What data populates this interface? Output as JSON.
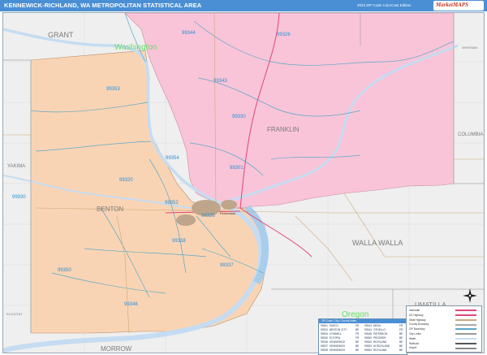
{
  "header": {
    "title": "KENNEWICK-RICHLAND, WA METROPOLITAN STATISTICAL AREA",
    "edition": "2023 ZIP Code ColorCast Edition",
    "brand": "MarketMAPS"
  },
  "colors": {
    "header_bg": "#4a8fd4",
    "benton_fill": "#f9d4b4",
    "franklin_fill": "#f9c4d8",
    "outside_fill": "#efefef",
    "water": "#c5dcf2",
    "zip_label": "#2a8fd6",
    "zip_border": "#5aa8c8",
    "county_label": "#7a7a7a",
    "state_label": "#66dd66",
    "highway": "#e0457b",
    "road": "#c9a97a"
  },
  "counties": {
    "grant": "GRANT",
    "yakima": "YAKIMA",
    "benton": "BENTON",
    "franklin": "FRANKLIN",
    "walla_walla": "WALLA WALLA",
    "columbia": "COLUMBIA",
    "whitman": "WHITMAN",
    "umatilla": "UMATILLA",
    "morrow": "MORROW",
    "klickitat": "KLICKITAT"
  },
  "states": {
    "washington": "Washington",
    "oregon": "Oregon"
  },
  "zips": {
    "z99344": "99344",
    "z99326": "99326",
    "z99343": "99343",
    "z99353": "99353",
    "z99330": "99330",
    "z99354": "99354",
    "z99301": "99301",
    "z99320": "99320",
    "z99930": "99930",
    "z99352": "99352",
    "z99336": "99336",
    "z99338": "99338",
    "z99337": "99337",
    "z99350": "99350",
    "z99348": "99348"
  },
  "cities": {
    "pasco": "Kennewick"
  },
  "legend": {
    "items": [
      "Interstate",
      "US Highway",
      "State Highway",
      "County Boundary",
      "ZIP Boundary",
      "City Limits",
      "Water",
      "Railroad",
      "Airport"
    ]
  },
  "zip_table": {
    "header": "ZIP Code / City / County Index",
    "rows": [
      [
        "99301",
        "PASCO",
        "FR"
      ],
      [
        "99320",
        "BENTON CITY",
        "BE"
      ],
      [
        "99326",
        "CONNELL",
        "FR"
      ],
      [
        "99330",
        "ELTOPIA",
        "FR"
      ],
      [
        "99336",
        "KENNEWICK",
        "BE"
      ],
      [
        "99337",
        "KENNEWICK",
        "BE"
      ],
      [
        "99338",
        "KENNEWICK",
        "BE"
      ],
      [
        "99343",
        "MESA",
        "FR"
      ],
      [
        "99344",
        "OTHELLO",
        "FR"
      ],
      [
        "99348",
        "PATERSON",
        "BE"
      ],
      [
        "99350",
        "PROSSER",
        "BE"
      ],
      [
        "99352",
        "RICHLAND",
        "BE"
      ],
      [
        "99353",
        "W RICHLAND",
        "BE"
      ],
      [
        "99354",
        "RICHLAND",
        "BE"
      ]
    ]
  }
}
